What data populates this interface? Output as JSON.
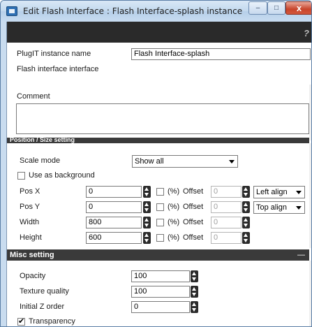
{
  "window": {
    "title": "Edit Flash Interface : Flash Interface-splash instance",
    "minimize": "–",
    "maximize": "□",
    "close": "x"
  },
  "toolbar": {
    "help": "?"
  },
  "general": {
    "instance_name_label": "PlugIT instance name",
    "instance_name_value": "Flash Interface-splash",
    "interface_label": "Flash interface interface",
    "comment_label": "Comment",
    "comment_value": ""
  },
  "position": {
    "header": "Position / Size setting",
    "scale_mode_label": "Scale mode",
    "scale_mode_value": "Show all",
    "use_background_label": "Use as background",
    "use_background_checked": false,
    "rows": [
      {
        "label": "Pos X",
        "value": "0",
        "percent_label": "(%)",
        "offset_label": "Offset",
        "offset_value": "0",
        "align": "Left align"
      },
      {
        "label": "Pos Y",
        "value": "0",
        "percent_label": "(%)",
        "offset_label": "Offset",
        "offset_value": "0",
        "align": "Top align"
      },
      {
        "label": "Width",
        "value": "800",
        "percent_label": "(%)",
        "offset_label": "Offset",
        "offset_value": "0"
      },
      {
        "label": "Height",
        "value": "600",
        "percent_label": "(%)",
        "offset_label": "Offset",
        "offset_value": "0"
      }
    ]
  },
  "misc": {
    "header": "Misc setting",
    "collapse": "—",
    "opacity_label": "Opacity",
    "opacity_value": "100",
    "texture_label": "Texture quality",
    "texture_value": "100",
    "zorder_label": "Initial Z order",
    "zorder_value": "0",
    "transparency_label": "Transparency",
    "transparency_checked": true
  },
  "colors": {
    "titlebar": "#c2d8ee",
    "dark_bar": "#2a2a2a",
    "section_header": "#3a3a3a",
    "close_button": "#c7442b"
  }
}
